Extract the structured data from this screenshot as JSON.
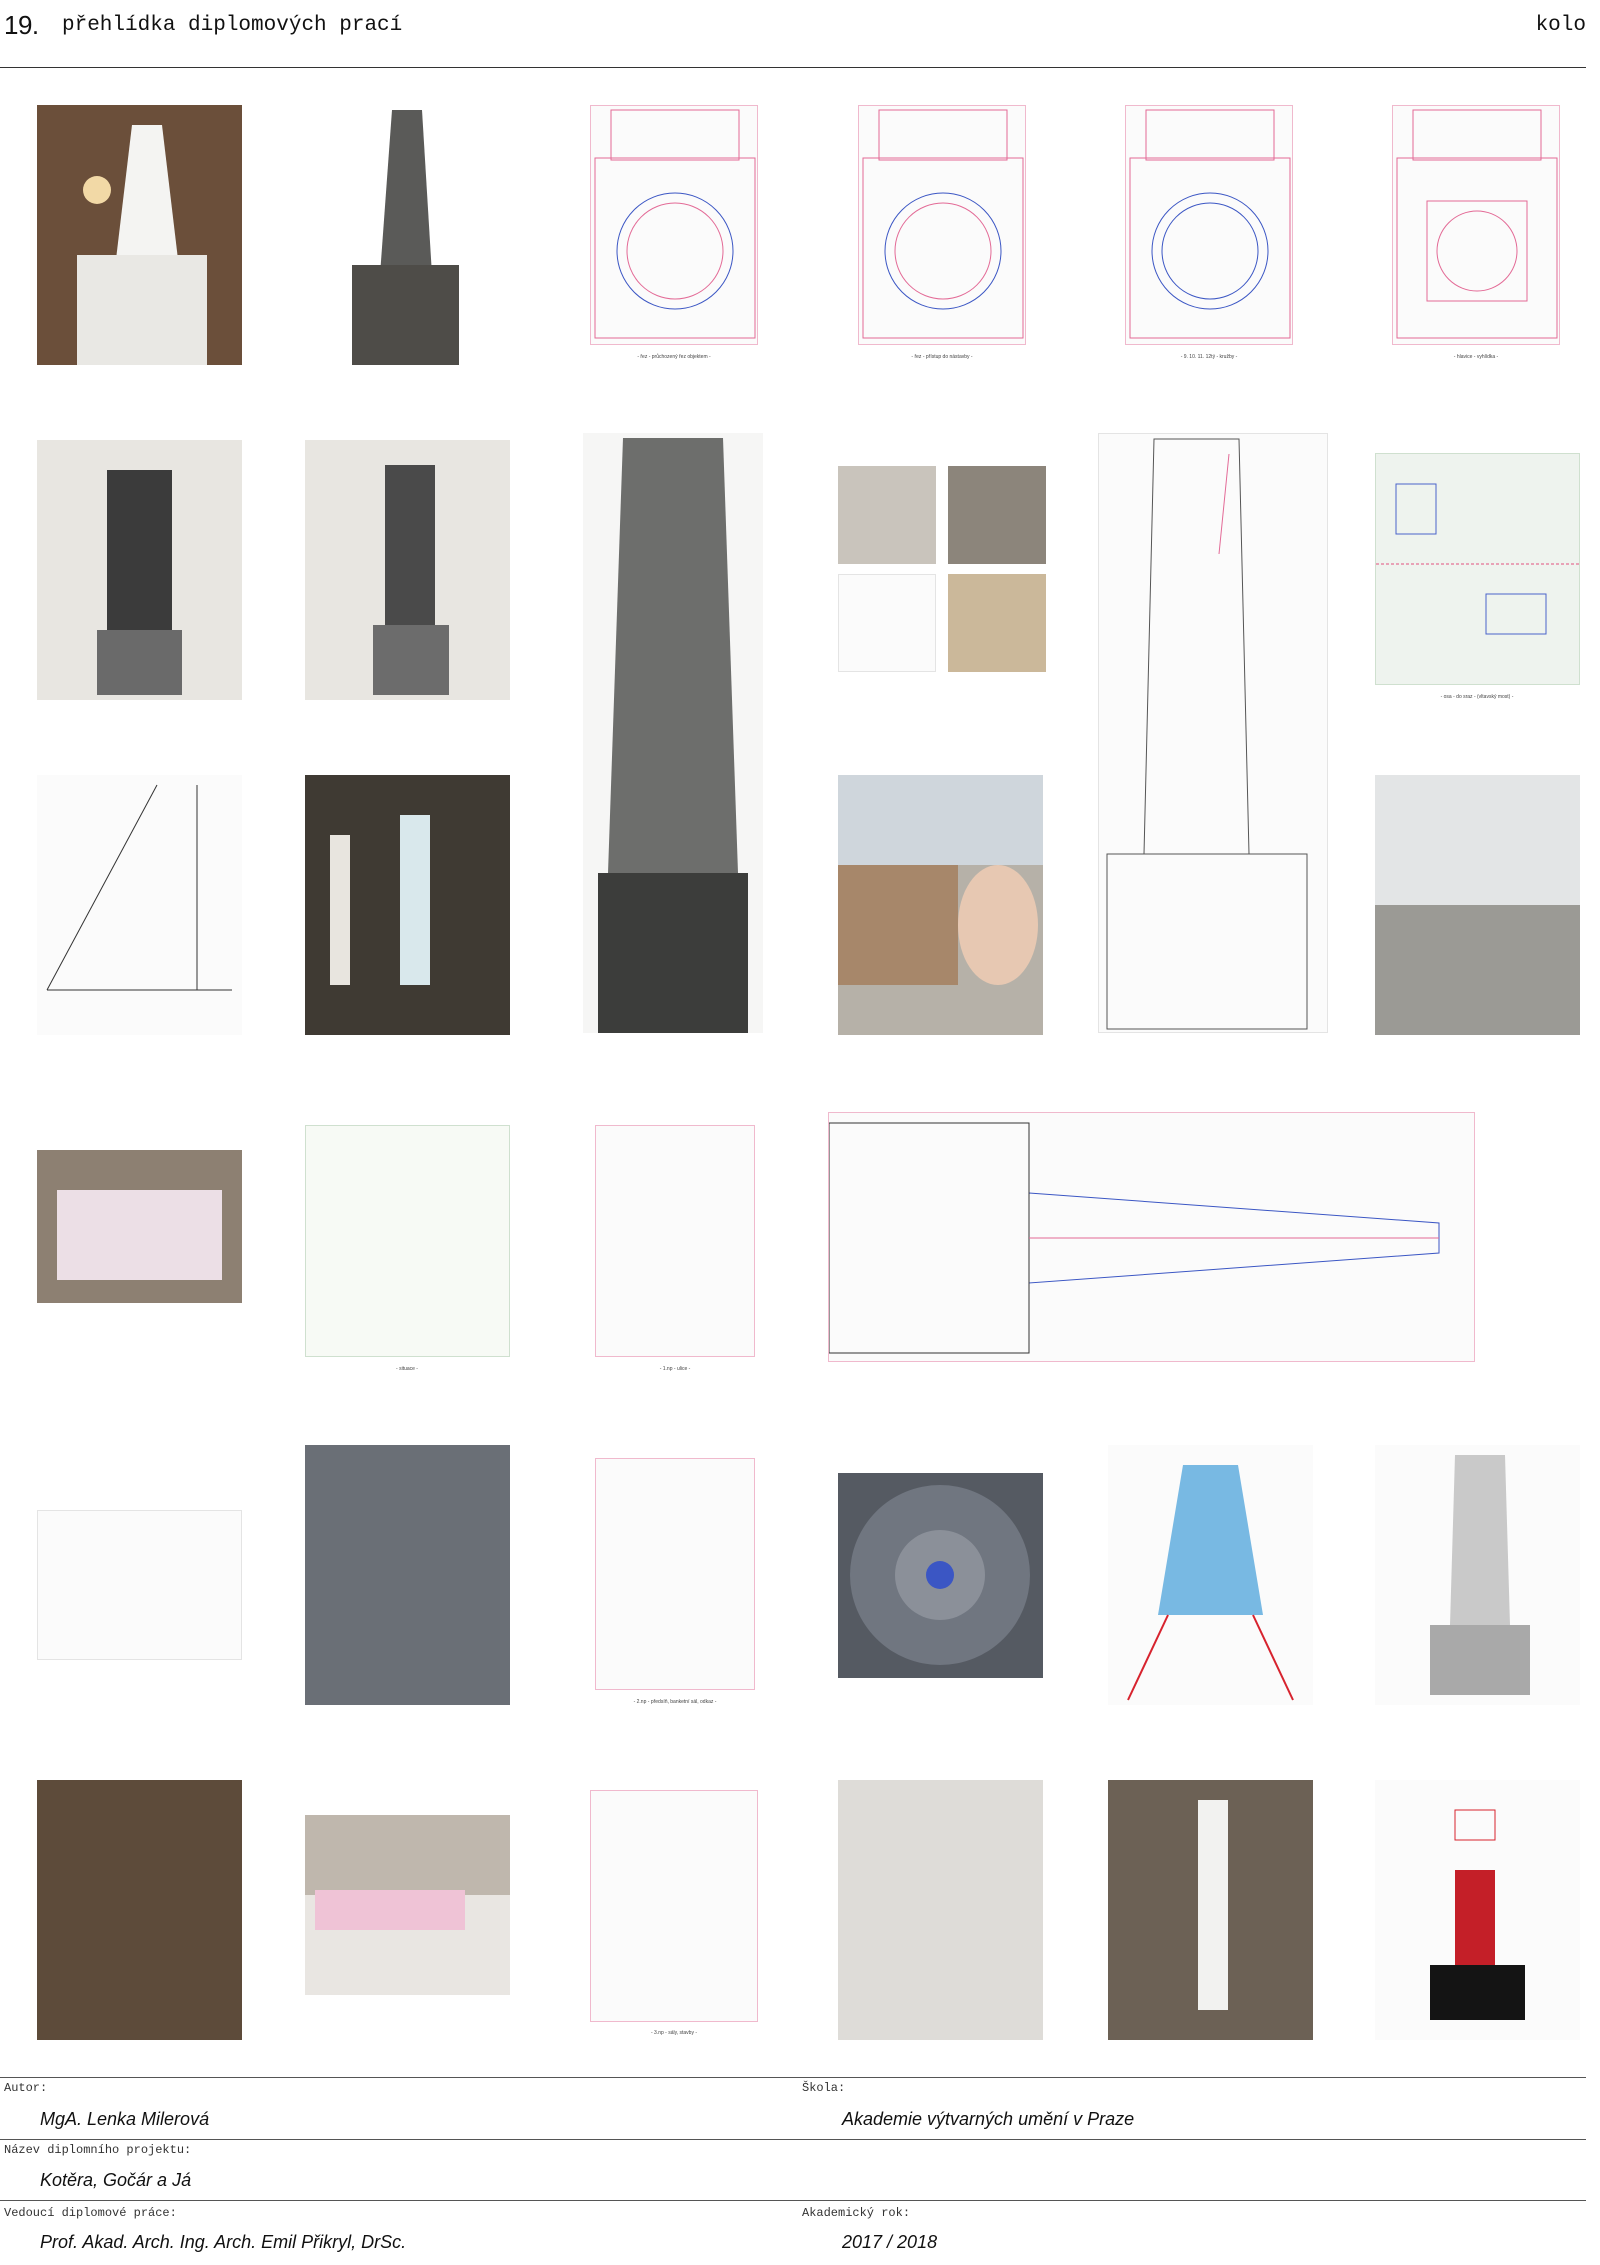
{
  "header": {
    "number": "19.",
    "title": "přehlídka diplomových prací",
    "round": "kolo"
  },
  "captions": {
    "plan_1": "- řez - průchozený řez objektem -",
    "plan_2": "- řez - přístup do nástavby -",
    "plan_3": "- 9. 10. 11. 12tý - kružby -",
    "plan_4": "- hlavice - vyhlídka -",
    "map_city": "- osa - do sraz - (vltavský most) -",
    "situation": "- situace -",
    "floor_1": "- 1.np - ulice -",
    "floor_2": "- 2.np - předsíň, banketní sál, odkaz -",
    "floor_3": "- 3.np - sály, stavby -"
  },
  "footer": {
    "author_label": "Autor:",
    "author": "MgA. Lenka Milerová",
    "school_label": "Škola:",
    "school": "Akademie výtvarných umění v Praze",
    "project_label": "Název diplomního projektu:",
    "project": "Kotěra, Gočár a Já",
    "supervisor_label": "Vedoucí diplomové práce:",
    "supervisor": "Prof. Akad. Arch. Ing. Arch. Emil Přikryl, DrSc.",
    "year_label": "Akademický rok:",
    "year": "2017 / 2018"
  }
}
